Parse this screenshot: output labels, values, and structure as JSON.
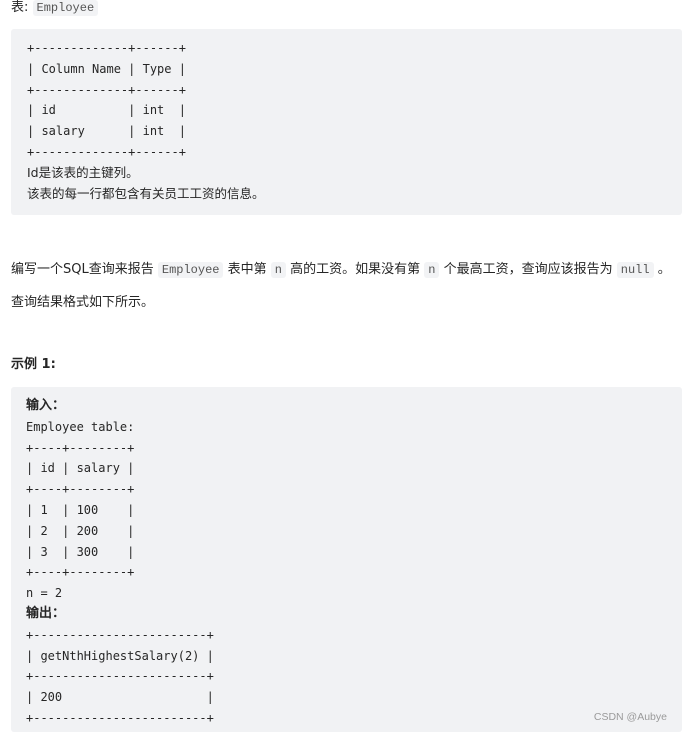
{
  "table_label": {
    "prefix": "表:",
    "name": "Employee"
  },
  "schema": {
    "lines": [
      "+-------------+------+",
      "| Column Name | Type |",
      "+-------------+------+",
      "| id          | int  |",
      "| salary      | int  |",
      "+-------------+------+"
    ],
    "notes": [
      "Id是该表的主键列。",
      "该表的每一行都包含有关员工工资的信息。"
    ]
  },
  "description": {
    "part1": "编写一个SQL查询来报告",
    "code1": "Employee",
    "part2": "表中第",
    "code2": "n",
    "part3": "高的工资。如果没有第",
    "code3": "n",
    "part4": "个最高工资，查询应该报告为",
    "code4": "null",
    "part5": "。"
  },
  "format_note": "查询结果格式如下所示。",
  "example": {
    "title": "示例 1:",
    "input_label": "输入：",
    "input_lines": [
      "Employee table:",
      "+----+--------+",
      "| id | salary |",
      "+----+--------+",
      "| 1  | 100    |",
      "| 2  | 200    |",
      "| 3  | 300    |",
      "+----+--------+",
      "n = 2"
    ],
    "output_label": "输出：",
    "output_lines": [
      "+------------------------+",
      "| getNthHighestSalary(2) |",
      "+------------------------+",
      "| 200                    |",
      "+------------------------+"
    ]
  },
  "watermark": "CSDN @Aubye"
}
